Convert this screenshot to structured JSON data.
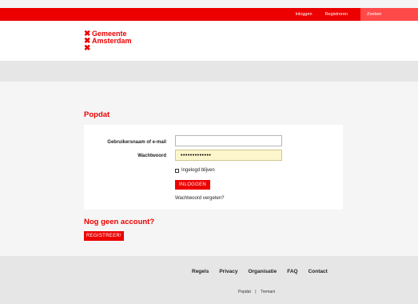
{
  "topbar": {
    "inloggen": "Inloggen",
    "registreren": "Registreren",
    "zoeken": "Zoeken",
    "accent": "#ec0000"
  },
  "logo": {
    "line1": "Gemeente",
    "line2": "Amsterdam"
  },
  "login": {
    "title": "Popdat",
    "username_label": "Gebruikersnaam of e-mail",
    "username_value": "",
    "password_label": "Wachtwoord",
    "password_value": "•••••••••••••",
    "remember_label": "Ingelogd blijven",
    "login_button": "INLOGGEN",
    "forgot_link": "Wachtwoord vergeten?"
  },
  "register": {
    "heading": "Nog geen account?",
    "button": "REGISTREER!"
  },
  "footer": {
    "links": [
      "Regels",
      "Privacy",
      "Organisatie",
      "FAQ",
      "Contact"
    ],
    "credit1": "Popdat",
    "separator": "|",
    "credit2": "Tremani"
  }
}
